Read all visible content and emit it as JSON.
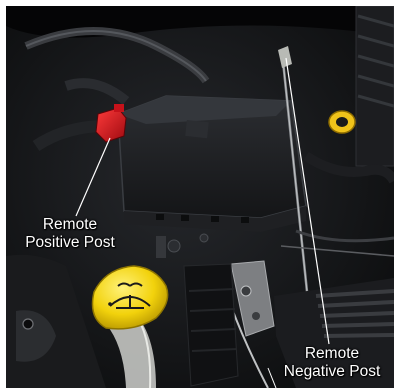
{
  "callouts": {
    "positive": {
      "line1": "Remote",
      "line2": "Positive Post"
    },
    "negative": {
      "line1": "Remote",
      "line2": "Negative Post"
    }
  },
  "colors": {
    "positive_cap": "#d8141e",
    "washer_cap": "#f2d20c",
    "oil_cap": "#f0c31a",
    "leader_line": "#ffffff"
  }
}
